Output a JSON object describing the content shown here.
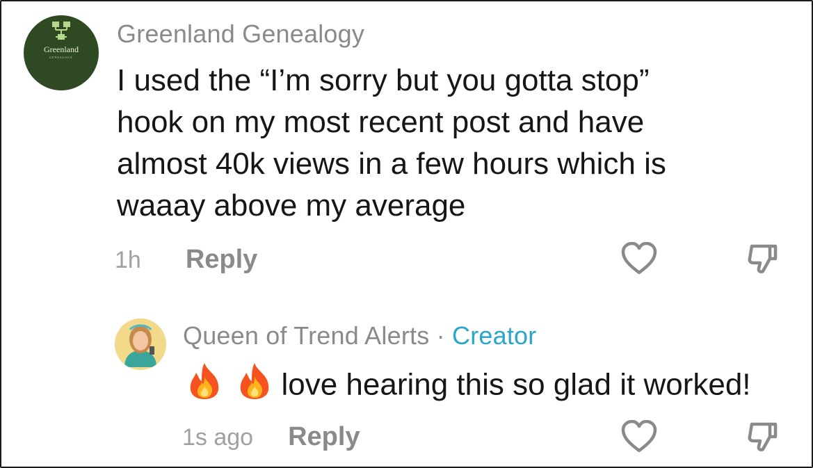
{
  "comment": {
    "avatar": {
      "brand_name": "Greenland",
      "brand_sub": "GENEALOGY",
      "bg_color": "#2f4a22",
      "icon": "family-tree-icon"
    },
    "username": "Greenland Genealogy",
    "text": "I used the “I’m sorry but you gotta stop”\nhook on my most recent post and have\nalmost 40k views in a few hours which is\nwaaay above my average",
    "time": "1h",
    "reply_label": "Reply",
    "like_icon": "heart-outline-icon",
    "dislike_icon": "thumbs-down-icon"
  },
  "reply": {
    "username": "Queen of Trend Alerts",
    "separator": "·",
    "badge": "Creator",
    "badge_color": "#2aa6c8",
    "emojis": [
      "fire-icon",
      "fire-icon"
    ],
    "text": "love hearing this so glad it worked!",
    "time": "1s ago",
    "reply_label": "Reply",
    "like_icon": "heart-outline-icon",
    "dislike_icon": "thumbs-down-icon"
  }
}
